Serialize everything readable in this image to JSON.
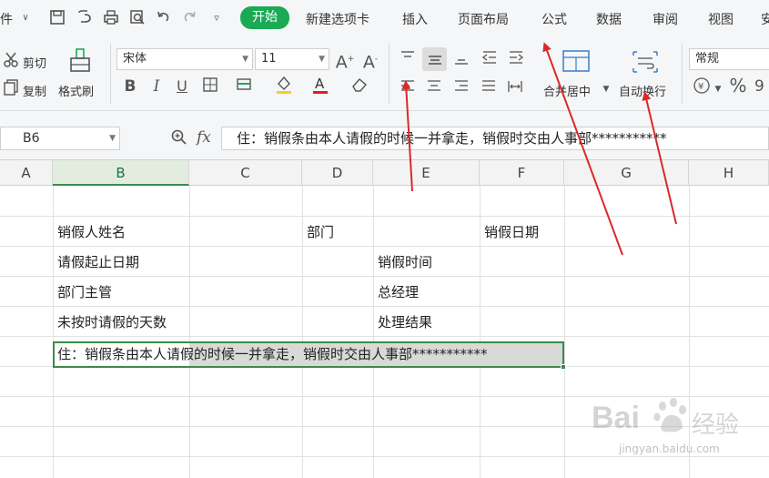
{
  "menu": {
    "file_fragment": "件",
    "tabs": [
      "开始",
      "新建选项卡",
      "插入",
      "页面布局",
      "公式",
      "数据",
      "审阅",
      "视图",
      "安"
    ]
  },
  "ribbon": {
    "cut_label": "剪切",
    "copy_label": "复制",
    "format_painter_label": "格式刷",
    "font_name": "宋体",
    "font_size": "11",
    "merge_center_label": "合并居中",
    "wrap_text_label": "自动换行",
    "number_format": "常规"
  },
  "formula_bar": {
    "cell_ref": "B6",
    "fx_label": "fx",
    "content": "住：销假条由本人请假的时候一并拿走，销假时交由人事部***********"
  },
  "grid": {
    "columns": [
      "A",
      "B",
      "C",
      "D",
      "E",
      "F",
      "G",
      "H"
    ],
    "selected_column": "B",
    "cells": {
      "b2": "销假人姓名",
      "d2": "部门",
      "f2": "销假日期",
      "b3": "请假起止日期",
      "e3": "销假时间",
      "b4": "部门主管",
      "e4": "总经理",
      "b5": "未按时请假的天数",
      "e5": "处理结果",
      "b6": "住：销假条由本人请假的时候一并拿走，销假时交由人事部***********"
    }
  },
  "watermark": {
    "brand": "Bai",
    "brand_cn": "经验",
    "url": "jingyan.baidu.com"
  },
  "colors": {
    "accent_green": "#1aaa55",
    "selection_green": "#3d8a4a",
    "arrow_red": "#d9292b"
  },
  "icons": [
    "save-icon",
    "print-icon",
    "print-preview-icon",
    "undo-icon",
    "redo-icon",
    "scissors-icon",
    "copy-icon",
    "brush-icon",
    "bold-icon",
    "italic-icon",
    "underline-icon",
    "border-icon",
    "fill-color-icon",
    "font-color-icon",
    "eraser-icon",
    "align-top-icon",
    "align-middle-icon",
    "align-bottom-icon",
    "indent-icon",
    "merge-icon",
    "wrap-icon",
    "currency-icon",
    "percent-icon",
    "zoom-icon"
  ]
}
